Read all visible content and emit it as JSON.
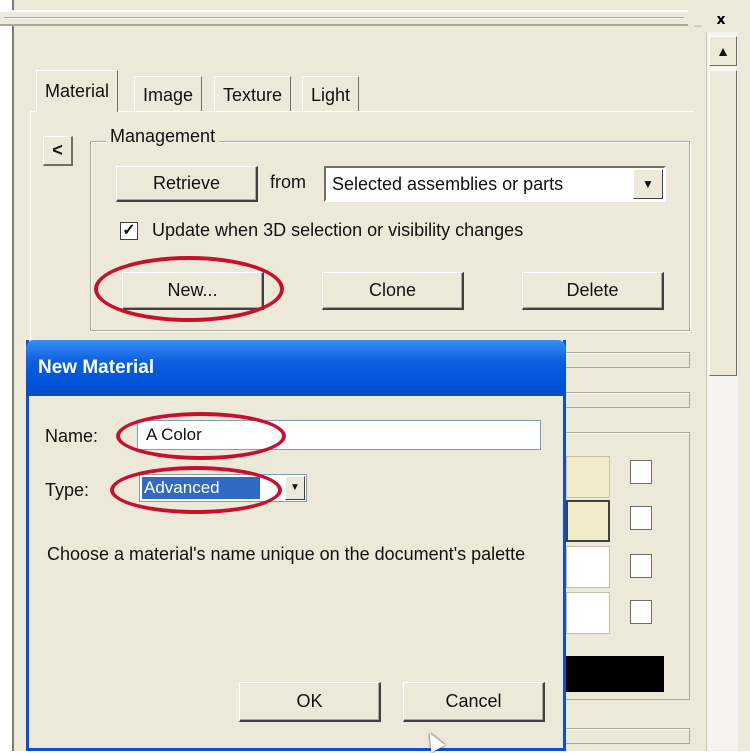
{
  "window": {
    "close_label": "x",
    "minimize_label": "_"
  },
  "tabs": [
    {
      "label": "Material",
      "active": true
    },
    {
      "label": "Image",
      "active": false
    },
    {
      "label": "Texture",
      "active": false
    },
    {
      "label": "Light",
      "active": false
    }
  ],
  "collapse_label": "<",
  "management": {
    "legend": "Management",
    "retrieve_label": "Retrieve",
    "from_label": "from",
    "source_value": "Selected assemblies or parts",
    "update_checked": true,
    "update_label": "Update when 3D selection or visibility changes",
    "new_label": "New...",
    "clone_label": "Clone",
    "delete_label": "Delete"
  },
  "dialog": {
    "title": "New Material",
    "name_label": "Name:",
    "name_value": "A Color",
    "type_label": "Type:",
    "type_value": "Advanced",
    "help_text": "Choose a material's name unique on the document's palette",
    "ok_label": "OK",
    "cancel_label": "Cancel"
  },
  "colors": {
    "panel_bg": "#ece9d8",
    "title_bar": "#0a5ee0",
    "highlight_ring": "#c8102e",
    "selection": "#316ac5"
  }
}
